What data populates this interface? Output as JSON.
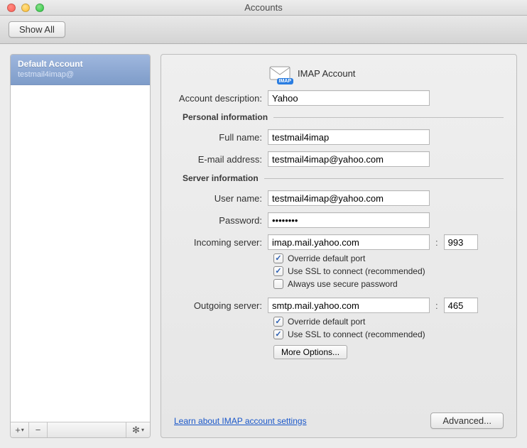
{
  "window": {
    "title": "Accounts"
  },
  "toolbar": {
    "show_all": "Show All"
  },
  "sidebar": {
    "account": {
      "title": "Default Account",
      "subtitle": "testmail4imap@"
    },
    "add_label": "+",
    "remove_label": "−",
    "gear_label": "⚙"
  },
  "main": {
    "header": "IMAP Account",
    "labels": {
      "description": "Account description:",
      "personal": "Personal information",
      "fullname": "Full name:",
      "email": "E-mail address:",
      "server": "Server information",
      "username": "User name:",
      "password": "Password:",
      "incoming": "Incoming server:",
      "outgoing": "Outgoing server:"
    },
    "values": {
      "description": "Yahoo",
      "fullname": "testmail4imap",
      "email": "testmail4imap@yahoo.com",
      "username": "testmail4imap@yahoo.com",
      "password": "••••••••",
      "incoming_server": "imap.mail.yahoo.com",
      "incoming_port": "993",
      "outgoing_server": "smtp.mail.yahoo.com",
      "outgoing_port": "465"
    },
    "checks": {
      "in_override": "Override default port",
      "in_ssl": "Use SSL to connect (recommended)",
      "in_secure": "Always use secure password",
      "out_override": "Override default port",
      "out_ssl": "Use SSL to connect (recommended)"
    },
    "buttons": {
      "more_options": "More Options...",
      "advanced": "Advanced..."
    },
    "link": "Learn about IMAP account settings"
  }
}
